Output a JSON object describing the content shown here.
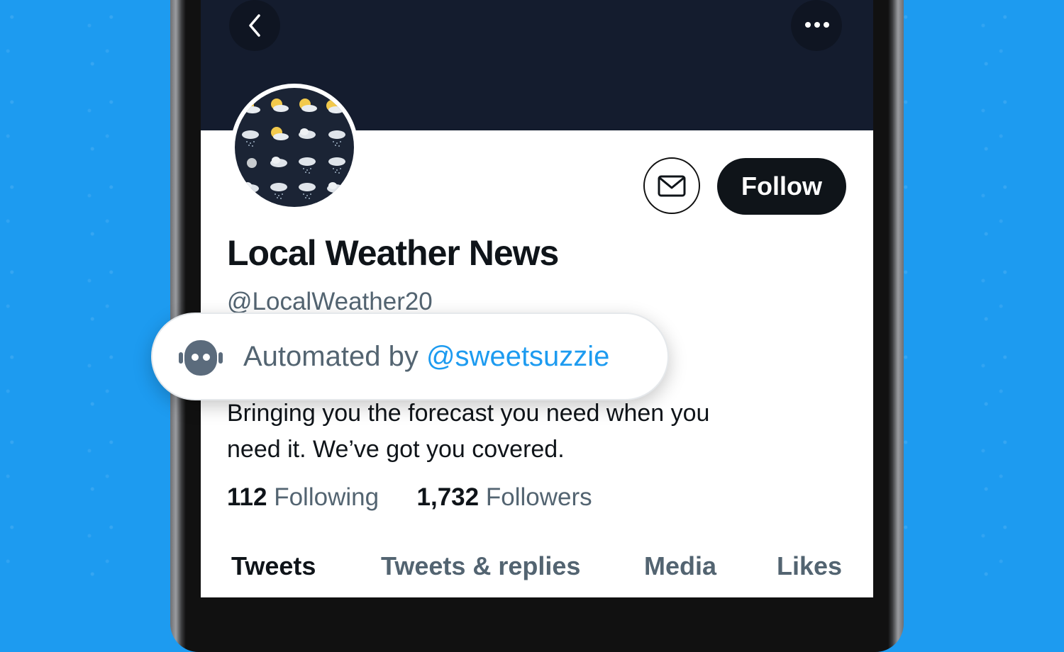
{
  "profile": {
    "display_name": "Local Weather News",
    "handle": "@LocalWeather20",
    "bio_line_1": "Bringing you the forecast you need when you",
    "bio_line_2": "need it.  We’ve got you covered.",
    "following_count": "112",
    "following_label": "Following",
    "followers_count": "1,732",
    "followers_label": "Followers"
  },
  "header": {
    "back_icon": "chevron-left-icon",
    "more_icon": "more-horizontal-icon",
    "banner_color": "#141c2e"
  },
  "actions": {
    "message_icon": "envelope-icon",
    "follow_label": "Follow"
  },
  "automated": {
    "label": "Automated by",
    "account": "@sweetsuzzie",
    "icon": "robot-icon"
  },
  "tabs": [
    {
      "label": "Tweets",
      "active": true
    },
    {
      "label": "Tweets & replies",
      "active": false
    },
    {
      "label": "Media",
      "active": false
    },
    {
      "label": "Likes",
      "active": false
    }
  ],
  "colors": {
    "accent": "#1d9bf0",
    "text_primary": "#0f1419",
    "text_secondary": "#536471"
  }
}
